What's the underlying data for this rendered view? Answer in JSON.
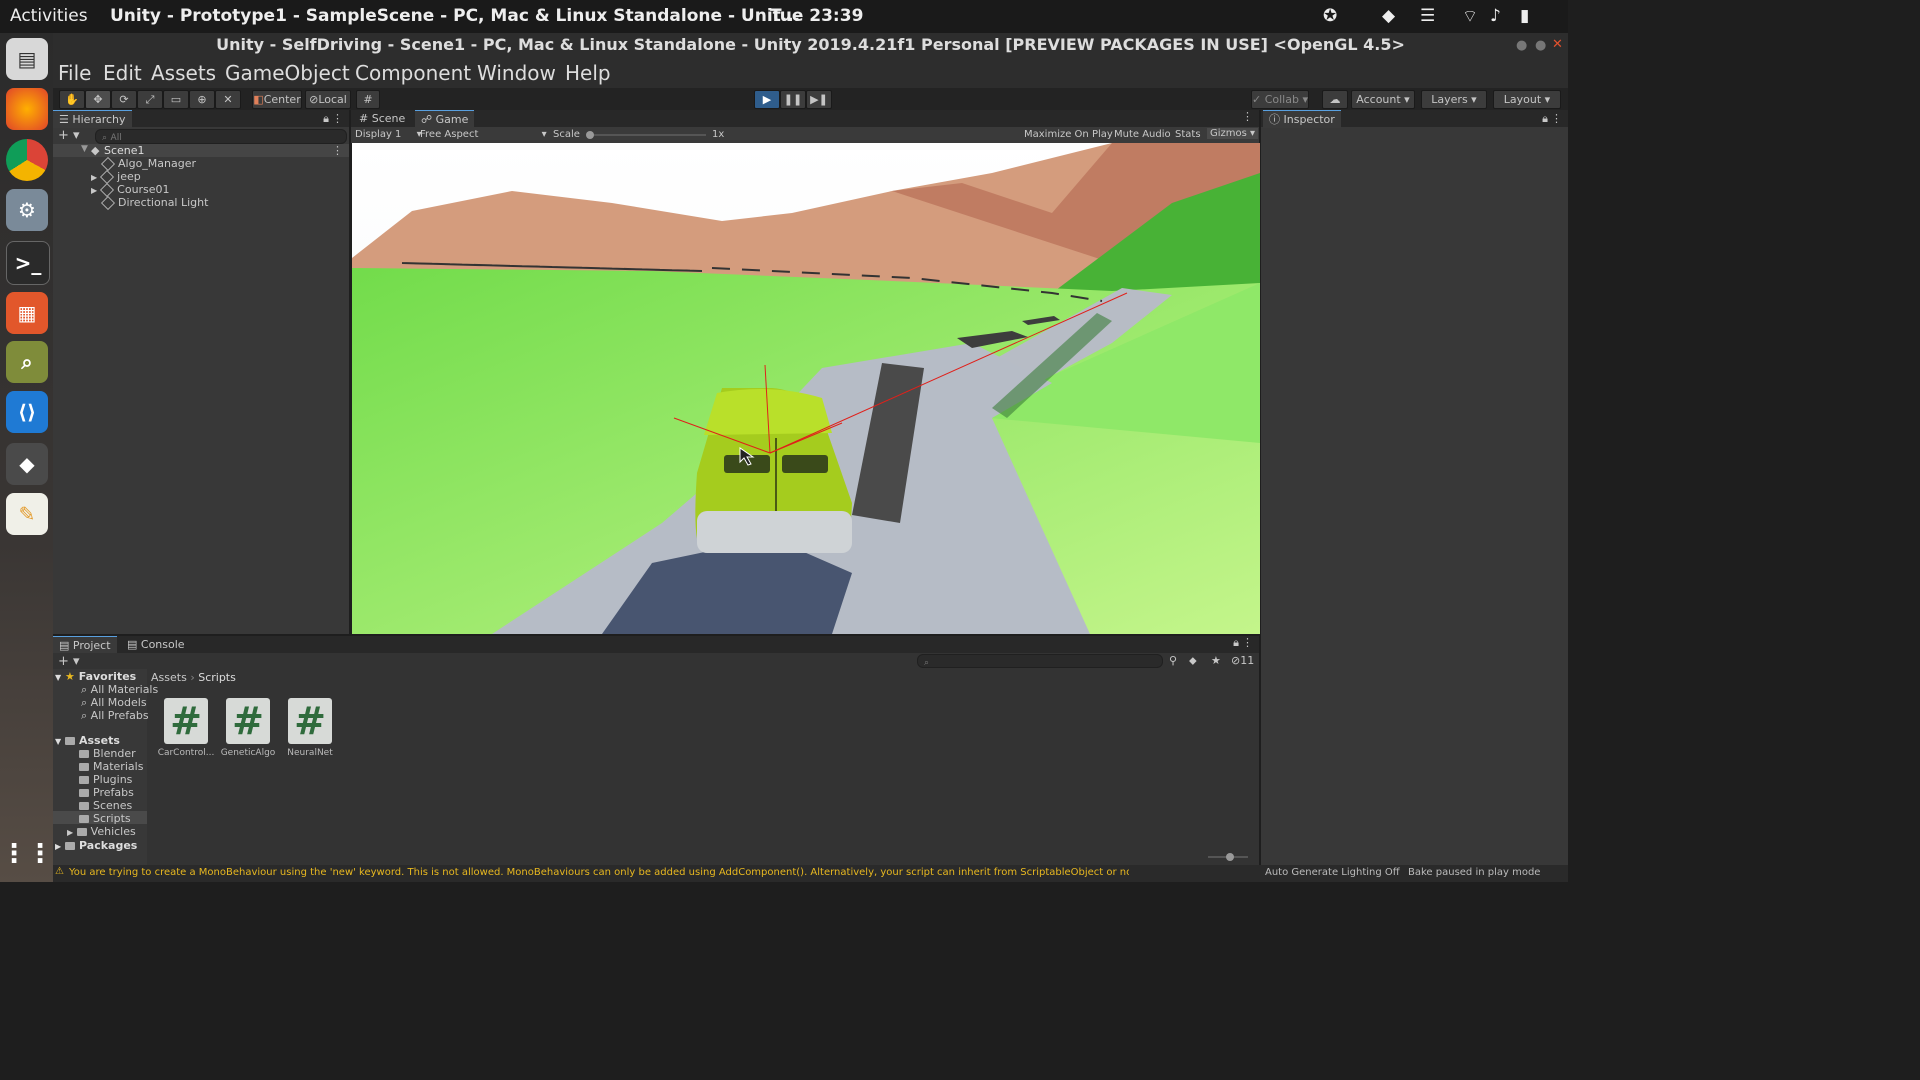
{
  "topbar": {
    "activities": "Activities",
    "app_window": "Unity - Prototype1 - SampleScene - PC, Mac & Linux Standalone - Unit...",
    "clock": "Tue 23:39"
  },
  "window": {
    "title": "Unity - SelfDriving - Scene1 - PC, Mac & Linux Standalone - Unity 2019.4.21f1 Personal [PREVIEW PACKAGES IN USE] <OpenGL 4.5>"
  },
  "menu": [
    "File",
    "Edit",
    "Assets",
    "GameObject",
    "Component",
    "Window",
    "Help"
  ],
  "toolbar": {
    "center_label": "Center",
    "local_label": "Local",
    "collab_label": "Collab",
    "account_label": "Account",
    "layers_label": "Layers",
    "layout_label": "Layout"
  },
  "hierarchy": {
    "tab": "Hierarchy",
    "search_placeholder": "All",
    "scene": "Scene1",
    "items": [
      "Algo_Manager",
      "jeep",
      "Course01",
      "Directional Light"
    ]
  },
  "game_view": {
    "tabs": [
      "Scene",
      "Game"
    ],
    "display": "Display 1",
    "aspect": "Free Aspect",
    "scale_label": "Scale",
    "scale_value": "1x",
    "maximize": "Maximize On Play",
    "mute": "Mute Audio",
    "stats": "Stats",
    "gizmos": "Gizmos"
  },
  "inspector": {
    "tab": "Inspector"
  },
  "project": {
    "tabs": [
      "Project",
      "Console"
    ],
    "favorites_label": "Favorites",
    "favorites": [
      "All Materials",
      "All Models",
      "All Prefabs"
    ],
    "assets_label": "Assets",
    "asset_folders": [
      "Blender",
      "Materials",
      "Plugins",
      "Prefabs",
      "Scenes",
      "Scripts",
      "Vehicles"
    ],
    "packages_label": "Packages",
    "breadcrumb": [
      "Assets",
      "Scripts"
    ],
    "hidden_count": "11",
    "scripts": [
      "CarControl...",
      "GeneticAlgo",
      "NeuralNet"
    ]
  },
  "statusbar": {
    "message": "You are trying to create a MonoBehaviour using the 'new' keyword.  This is not allowed.  MonoBehaviours can only be added using AddComponent(). Alternatively, your script can inherit from ScriptableObject or no base class at all",
    "lighting": "Auto Generate Lighting Off",
    "bake": "Bake paused in play mode"
  },
  "colors": {
    "play_active": "#3a72b0",
    "accent_tab": "#59a0e0",
    "grass": "#7dd85a",
    "road": "#b6bcc6"
  }
}
